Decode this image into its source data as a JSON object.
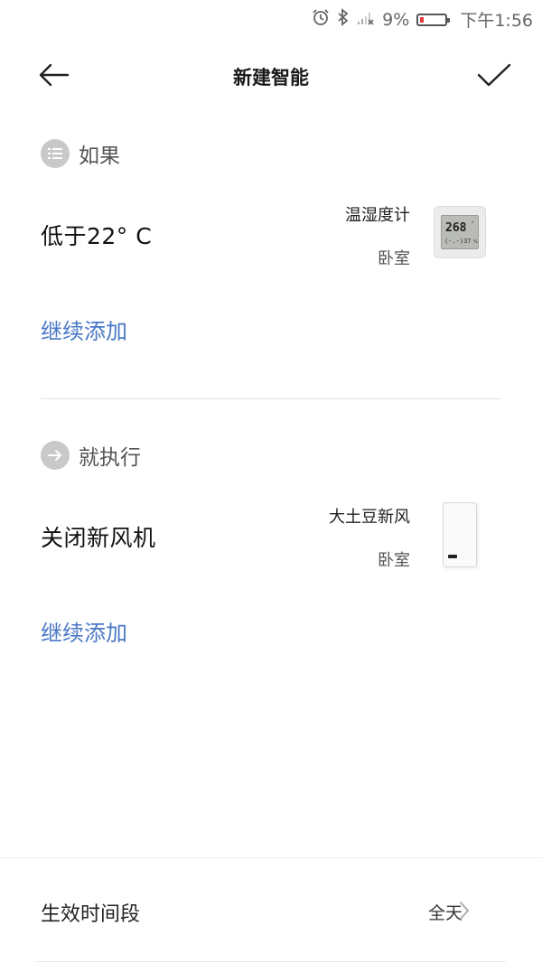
{
  "status_bar": {
    "battery": "9%",
    "time": "下午1:56"
  },
  "header": {
    "title": "新建智能"
  },
  "if_section": {
    "label": "如果",
    "condition": "低于22°  C",
    "device_name": "温湿度计",
    "device_room": "卧室",
    "add_more": "继续添加"
  },
  "then_section": {
    "label": "就执行",
    "action": "关闭新风机",
    "device_name": "大土豆新风",
    "device_room": "卧室",
    "add_more": "继续添加"
  },
  "active_period": {
    "label": "生效时间段",
    "value": "全天"
  },
  "colors": {
    "accent": "#4a78c6",
    "badge": "#c9c9c9",
    "battery_low": "#e03a3a"
  },
  "icons": [
    "alarm-icon",
    "bluetooth-icon",
    "signal-icon",
    "battery-icon",
    "back-arrow-icon",
    "checkmark-icon",
    "list-icon",
    "arrow-right-icon",
    "chevron-right-icon"
  ]
}
